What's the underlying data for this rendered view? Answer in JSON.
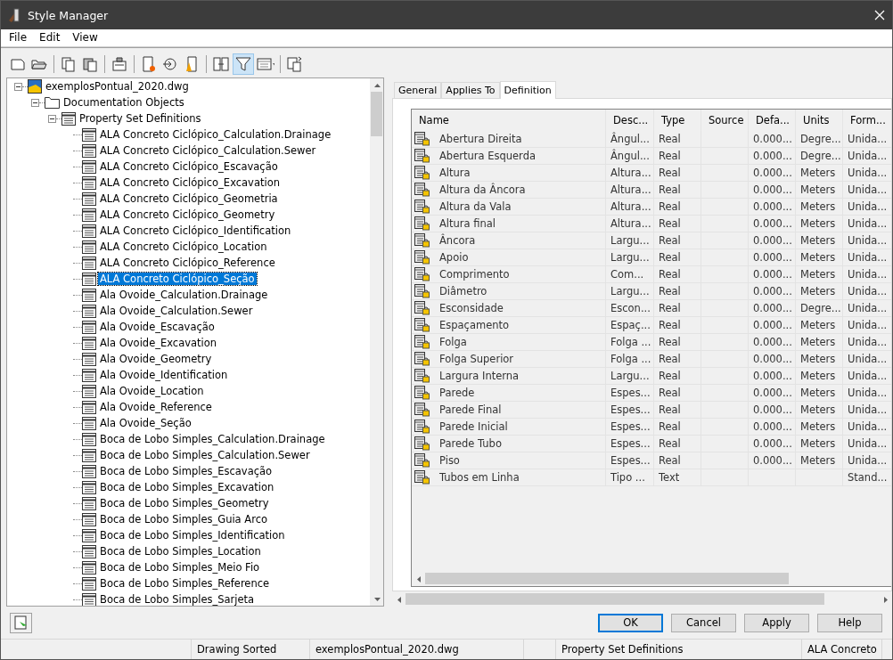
{
  "window": {
    "title": "Style Manager"
  },
  "menu": [
    "File",
    "Edit",
    "View"
  ],
  "toolbar": [
    {
      "kind": "new",
      "selected": false
    },
    {
      "kind": "open",
      "selected": false
    },
    {
      "kind": "sep"
    },
    {
      "kind": "copy",
      "selected": false
    },
    {
      "kind": "paste",
      "selected": false
    },
    {
      "kind": "sep"
    },
    {
      "kind": "purge",
      "selected": false
    },
    {
      "kind": "sep"
    },
    {
      "kind": "newstyle",
      "selected": false
    },
    {
      "kind": "edit",
      "selected": false
    },
    {
      "kind": "setcurrent",
      "selected": false
    },
    {
      "kind": "sep"
    },
    {
      "kind": "compare",
      "selected": false
    },
    {
      "kind": "filter",
      "selected": true
    },
    {
      "kind": "view",
      "selected": false
    },
    {
      "kind": "sep"
    },
    {
      "kind": "toggle",
      "selected": false
    }
  ],
  "tree": [
    {
      "label": "exemplosPontual_2020.dwg",
      "kind": "drawing",
      "expanded": true,
      "selected": false,
      "children": [
        {
          "label": "Documentation Objects",
          "kind": "folder",
          "expanded": true,
          "selected": false,
          "children": [
            {
              "label": "Property Set Definitions",
              "kind": "category",
              "expanded": true,
              "selected": false,
              "children": [
                {
                  "label": "ALA Concreto Ciclópico_Calculation.Drainage",
                  "kind": "style",
                  "selected": false
                },
                {
                  "label": "ALA Concreto Ciclópico_Calculation.Sewer",
                  "kind": "style",
                  "selected": false
                },
                {
                  "label": "ALA Concreto Ciclópico_Escavação",
                  "kind": "style",
                  "selected": false
                },
                {
                  "label": "ALA Concreto Ciclópico_Excavation",
                  "kind": "style",
                  "selected": false
                },
                {
                  "label": "ALA Concreto Ciclópico_Geometria",
                  "kind": "style",
                  "selected": false
                },
                {
                  "label": "ALA Concreto Ciclópico_Geometry",
                  "kind": "style",
                  "selected": false
                },
                {
                  "label": "ALA Concreto Ciclópico_Identification",
                  "kind": "style",
                  "selected": false
                },
                {
                  "label": "ALA Concreto Ciclópico_Location",
                  "kind": "style",
                  "selected": false
                },
                {
                  "label": "ALA Concreto Ciclópico_Reference",
                  "kind": "style",
                  "selected": false
                },
                {
                  "label": "ALA Concreto Ciclópico_Seção",
                  "kind": "style",
                  "selected": true
                },
                {
                  "label": "Ala Ovoide_Calculation.Drainage",
                  "kind": "style",
                  "selected": false
                },
                {
                  "label": "Ala Ovoide_Calculation.Sewer",
                  "kind": "style",
                  "selected": false
                },
                {
                  "label": "Ala Ovoide_Escavação",
                  "kind": "style",
                  "selected": false
                },
                {
                  "label": "Ala Ovoide_Excavation",
                  "kind": "style",
                  "selected": false
                },
                {
                  "label": "Ala Ovoide_Geometry",
                  "kind": "style",
                  "selected": false
                },
                {
                  "label": "Ala Ovoide_Identification",
                  "kind": "style",
                  "selected": false
                },
                {
                  "label": "Ala Ovoide_Location",
                  "kind": "style",
                  "selected": false
                },
                {
                  "label": "Ala Ovoide_Reference",
                  "kind": "style",
                  "selected": false
                },
                {
                  "label": "Ala Ovoide_Seção",
                  "kind": "style",
                  "selected": false
                },
                {
                  "label": "Boca de Lobo Simples_Calculation.Drainage",
                  "kind": "style",
                  "selected": false
                },
                {
                  "label": "Boca de Lobo Simples_Calculation.Sewer",
                  "kind": "style",
                  "selected": false
                },
                {
                  "label": "Boca de Lobo Simples_Escavação",
                  "kind": "style",
                  "selected": false
                },
                {
                  "label": "Boca de Lobo Simples_Excavation",
                  "kind": "style",
                  "selected": false
                },
                {
                  "label": "Boca de Lobo Simples_Geometry",
                  "kind": "style",
                  "selected": false
                },
                {
                  "label": "Boca de Lobo Simples_Guia Arco",
                  "kind": "style",
                  "selected": false
                },
                {
                  "label": "Boca de Lobo Simples_Identification",
                  "kind": "style",
                  "selected": false
                },
                {
                  "label": "Boca de Lobo Simples_Location",
                  "kind": "style",
                  "selected": false
                },
                {
                  "label": "Boca de Lobo Simples_Meio Fio",
                  "kind": "style",
                  "selected": false
                },
                {
                  "label": "Boca de Lobo Simples_Reference",
                  "kind": "style",
                  "selected": false
                },
                {
                  "label": "Boca de Lobo Simples_Sarjeta",
                  "kind": "style",
                  "selected": false
                }
              ]
            }
          ]
        }
      ]
    }
  ],
  "tabs": [
    {
      "label": "General",
      "selected": false
    },
    {
      "label": "Applies To",
      "selected": false
    },
    {
      "label": "Definition",
      "selected": true
    }
  ],
  "table": {
    "columns": [
      "Name",
      "Desc...",
      "Type",
      "Source",
      "Defa...",
      "Units",
      "Form..."
    ],
    "rows": [
      [
        "Abertura Direita",
        "Ângul...",
        "Real",
        null,
        "0.000...",
        "Degre...",
        "Unida..."
      ],
      [
        "Abertura Esquerda",
        "Ângul...",
        "Real",
        null,
        "0.000...",
        "Degre...",
        "Unida..."
      ],
      [
        "Altura",
        "Altura...",
        "Real",
        null,
        "0.000...",
        "Meters",
        "Unida..."
      ],
      [
        "Altura da Âncora",
        "Altura...",
        "Real",
        null,
        "0.000...",
        "Meters",
        "Unida..."
      ],
      [
        "Altura da Vala",
        "Altura...",
        "Real",
        null,
        "0.000...",
        "Meters",
        "Unida..."
      ],
      [
        "Altura final",
        "Altura...",
        "Real",
        null,
        "0.000...",
        "Meters",
        "Unida..."
      ],
      [
        "Âncora",
        "Largu...",
        "Real",
        null,
        "0.000...",
        "Meters",
        "Unida..."
      ],
      [
        "Apoio",
        "Largu...",
        "Real",
        null,
        "0.000...",
        "Meters",
        "Unida..."
      ],
      [
        "Comprimento",
        "Com...",
        "Real",
        null,
        "0.000...",
        "Meters",
        "Unida..."
      ],
      [
        "Diâmetro",
        "Largu...",
        "Real",
        null,
        "0.000...",
        "Meters",
        "Unida..."
      ],
      [
        "Esconsidade",
        "Escon...",
        "Real",
        null,
        "0.000...",
        "Degre...",
        "Unida..."
      ],
      [
        "Espaçamento",
        "Espaç...",
        "Real",
        null,
        "0.000...",
        "Meters",
        "Unida..."
      ],
      [
        "Folga",
        "Folga ...",
        "Real",
        null,
        "0.000...",
        "Meters",
        "Unida..."
      ],
      [
        "Folga Superior",
        "Folga ...",
        "Real",
        null,
        "0.000...",
        "Meters",
        "Unida..."
      ],
      [
        "Largura Interna",
        "Largu...",
        "Real",
        null,
        "0.000...",
        "Meters",
        "Unida..."
      ],
      [
        "Parede",
        "Espes...",
        "Real",
        null,
        "0.000...",
        "Meters",
        "Unida..."
      ],
      [
        "Parede Final",
        "Espes...",
        "Real",
        null,
        "0.000...",
        "Meters",
        "Unida..."
      ],
      [
        "Parede Inicial",
        "Espes...",
        "Real",
        null,
        "0.000...",
        "Meters",
        "Unida..."
      ],
      [
        "Parede Tubo",
        "Espes...",
        "Real",
        null,
        "0.000...",
        "Meters",
        "Unida..."
      ],
      [
        "Piso",
        "Espes...",
        "Real",
        null,
        "0.000...",
        "Meters",
        "Unida..."
      ],
      [
        "Tubos em Linha",
        "Tipo ...",
        "Text",
        null,
        null,
        null,
        "Stand..."
      ]
    ]
  },
  "buttons": [
    "OK",
    "Cancel",
    "Apply",
    "Help"
  ],
  "status_bar": [
    "Drawing Sorted",
    "exemplosPontual_2020.dwg",
    "Property Set Definitions",
    "ALA Concreto"
  ]
}
